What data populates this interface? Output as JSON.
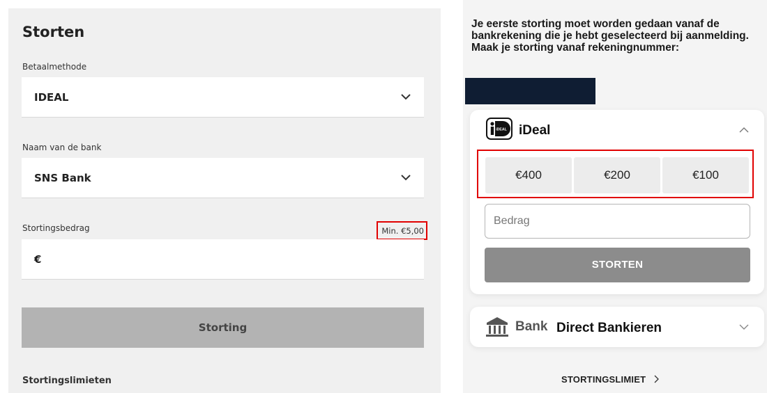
{
  "left_form": {
    "title": "Storten",
    "payment_method_label": "Betaalmethode",
    "payment_method_value": "IDEAL",
    "bank_name_label": "Naam van de bank",
    "bank_name_value": "SNS Bank",
    "amount_label": "Stortingsbedrag",
    "min_amount": "Min. €5,00",
    "currency_symbol": "€",
    "submit_label": "Storting",
    "limits_label": "Stortingslimieten"
  },
  "right_form": {
    "info_text": "Je eerste storting moet worden gedaan vanaf de bankrekening die je hebt geselecteerd bij aanmelding. Maak je storting vanaf rekeningnummer:",
    "ideal_section": {
      "logo_text": "iDEAL",
      "title": "iDeal",
      "quick_amounts": [
        "€400",
        "€200",
        "€100"
      ],
      "amount_placeholder": "Bedrag",
      "submit_label": "STORTEN"
    },
    "bank_section": {
      "icon_label": "Bank",
      "title": "Direct Bankieren"
    },
    "limit_link": "STORTINGSLIMIET"
  },
  "colors": {
    "highlight_box": "#e10000",
    "masked_account": "#0f1d33",
    "left_button_bg": "#b3b3b3",
    "right_button_bg": "#8c8c8c"
  },
  "icons": [
    "chevron-down-icon",
    "chevron-up-icon",
    "ideal-logo-icon",
    "bank-building-icon",
    "chevron-right-icon"
  ]
}
